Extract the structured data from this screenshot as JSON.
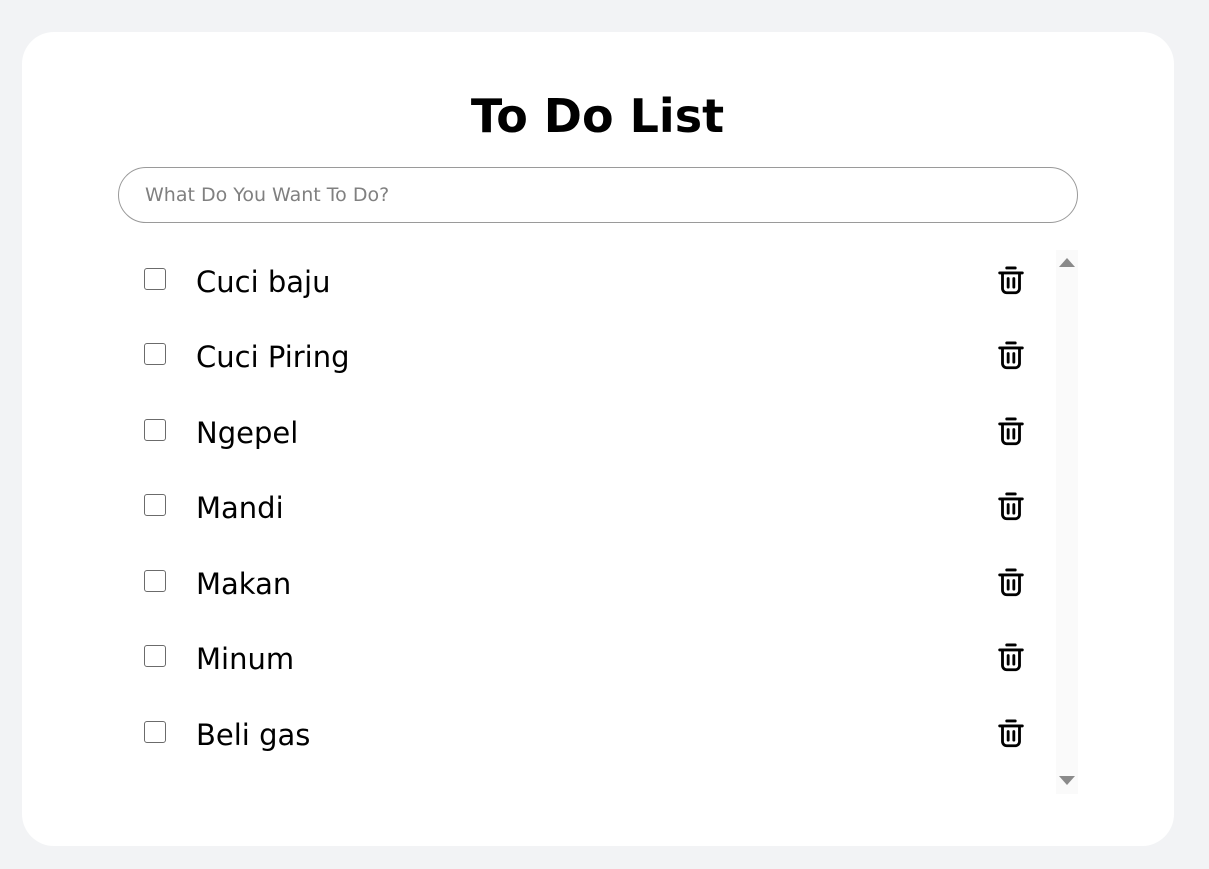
{
  "app": {
    "title": "To Do List"
  },
  "input": {
    "placeholder": "What Do You Want To Do?",
    "value": ""
  },
  "todos": [
    {
      "label": "Cuci baju",
      "checked": false
    },
    {
      "label": "Cuci Piring",
      "checked": false
    },
    {
      "label": "Ngepel",
      "checked": false
    },
    {
      "label": "Mandi",
      "checked": false
    },
    {
      "label": "Makan",
      "checked": false
    },
    {
      "label": "Minum",
      "checked": false
    },
    {
      "label": "Beli gas",
      "checked": false
    }
  ],
  "icons": {
    "delete": "trash-icon",
    "scroll_up": "scroll-up-arrow-icon",
    "scroll_down": "scroll-down-arrow-icon"
  },
  "colors": {
    "page_background": "#f2f3f5",
    "card_background": "#ffffff",
    "text": "#000000",
    "placeholder": "#808080"
  }
}
